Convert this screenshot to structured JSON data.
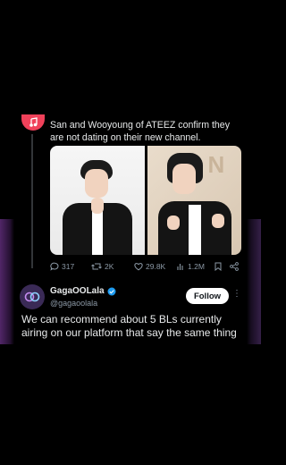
{
  "tweet1": {
    "text": "San and Wooyoung of ATEEZ confirm they are not dating on their new channel.",
    "image_right_backdrop_text": "D N",
    "stats": {
      "replies": "317",
      "retweets": "2K",
      "likes": "29.8K",
      "views": "1.2M"
    }
  },
  "tweet2": {
    "display_name": "GagaOOLala",
    "handle": "@gagaoolala",
    "follow_label": "Follow",
    "text": "We can recommend about 5 BLs currently airing on our platform that say the same thing"
  },
  "colors": {
    "background": "#000000",
    "text": "#e7e9ea",
    "muted": "#8b98a5",
    "verified": "#1d9bf0",
    "avatar1": "#f0415a"
  }
}
